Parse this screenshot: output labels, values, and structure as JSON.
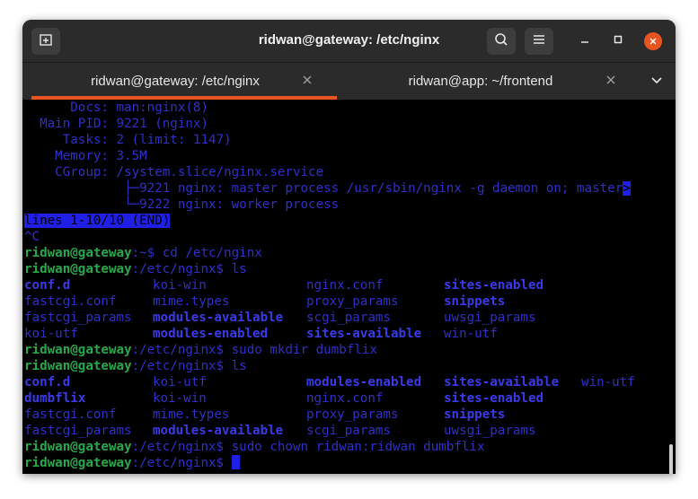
{
  "window": {
    "title": "ridwan@gateway: /etc/nginx",
    "accent": "#e95420"
  },
  "tabs": [
    {
      "label": "ridwan@gateway: /etc/nginx",
      "active": true
    },
    {
      "label": "ridwan@app: ~/frontend",
      "active": false
    }
  ],
  "icons": {
    "new_tab": "new-tab-icon",
    "search": "search-icon",
    "menu": "hamburger-menu-icon",
    "minimize": "minimize-icon",
    "maximize": "maximize-icon",
    "close": "close-icon",
    "tabs_dropdown": "chevron-down-icon"
  },
  "terminal": {
    "status": {
      "docs_key": "      Docs:",
      "docs_val": " man:nginx(8)",
      "pid_key": "  Main PID:",
      "pid_val": " 9221 (nginx)",
      "tasks_key": "     Tasks:",
      "tasks_val": " 2 (limit: 1147)",
      "mem_key": "    Memory:",
      "mem_val": " 3.5M",
      "cgroup_key": "    CGroup:",
      "cgroup_val": " /system.slice/nginx.service",
      "proc1": "             ├─9221 nginx: master process /usr/sbin/nginx -g daemon on; master",
      "proc1_more": ">",
      "proc2": "             └─9222 nginx: worker process"
    },
    "pager_status": "lines 1-10/10 (END)",
    "interrupt": "^C",
    "prompt_user": "ridwan@gateway",
    "prompt_home": ":~$",
    "prompt_nginx": ":/etc/nginx$",
    "cmd1": " cd /etc/nginx",
    "cmd2": " ls",
    "cmd3": " sudo mkdir dumbflix",
    "cmd4": " ls",
    "cmd5": " sudo chown ridwan:ridwan dumbflix",
    "ls1": [
      [
        "conf.d",
        "koi-win",
        "nginx.conf",
        "sites-enabled"
      ],
      [
        "fastcgi.conf",
        "mime.types",
        "proxy_params",
        "snippets"
      ],
      [
        "fastcgi_params",
        "modules-available",
        "scgi_params",
        "uwsgi_params"
      ],
      [
        "koi-utf",
        "modules-enabled",
        "sites-available",
        "win-utf"
      ]
    ],
    "ls2": [
      [
        "conf.d",
        "koi-utf",
        "modules-enabled",
        "sites-available",
        "win-utf"
      ],
      [
        "dumbflix",
        "koi-win",
        "nginx.conf",
        "sites-enabled",
        ""
      ],
      [
        "fastcgi.conf",
        "mime.types",
        "proxy_params",
        "snippets",
        ""
      ],
      [
        "fastcgi_params",
        "modules-available",
        "scgi_params",
        "uwsgi_params",
        ""
      ]
    ]
  }
}
